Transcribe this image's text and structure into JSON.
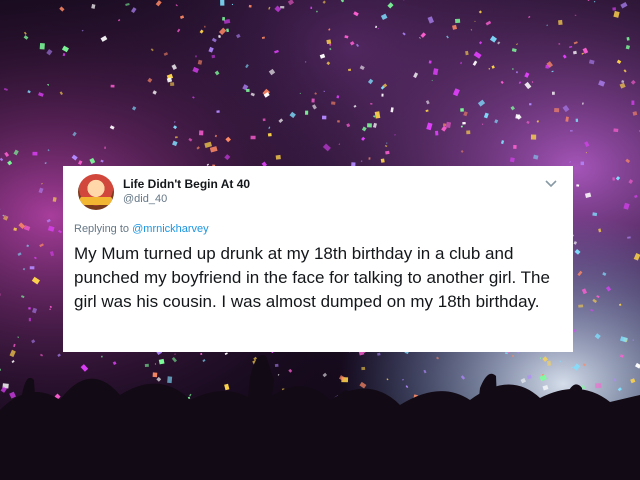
{
  "tweet": {
    "display_name": "Life Didn't Begin At 40",
    "handle": "@did_40",
    "reply_prefix": "Replying to",
    "reply_to": "@mrnickharvey",
    "text": "My Mum turned up drunk at my 18th birthday in a club and punched my boyfriend in the face for talking to another girl. The girl was his cousin. I was almost dumped on my 18th birthday.",
    "menu_icon": "chevron-down-icon",
    "avatar_icon": "avatar"
  },
  "background": {
    "description_icon": "confetti-crowd-photo"
  },
  "colors": {
    "link": "#1b95e0",
    "text": "#14171a",
    "muted": "#657786"
  }
}
